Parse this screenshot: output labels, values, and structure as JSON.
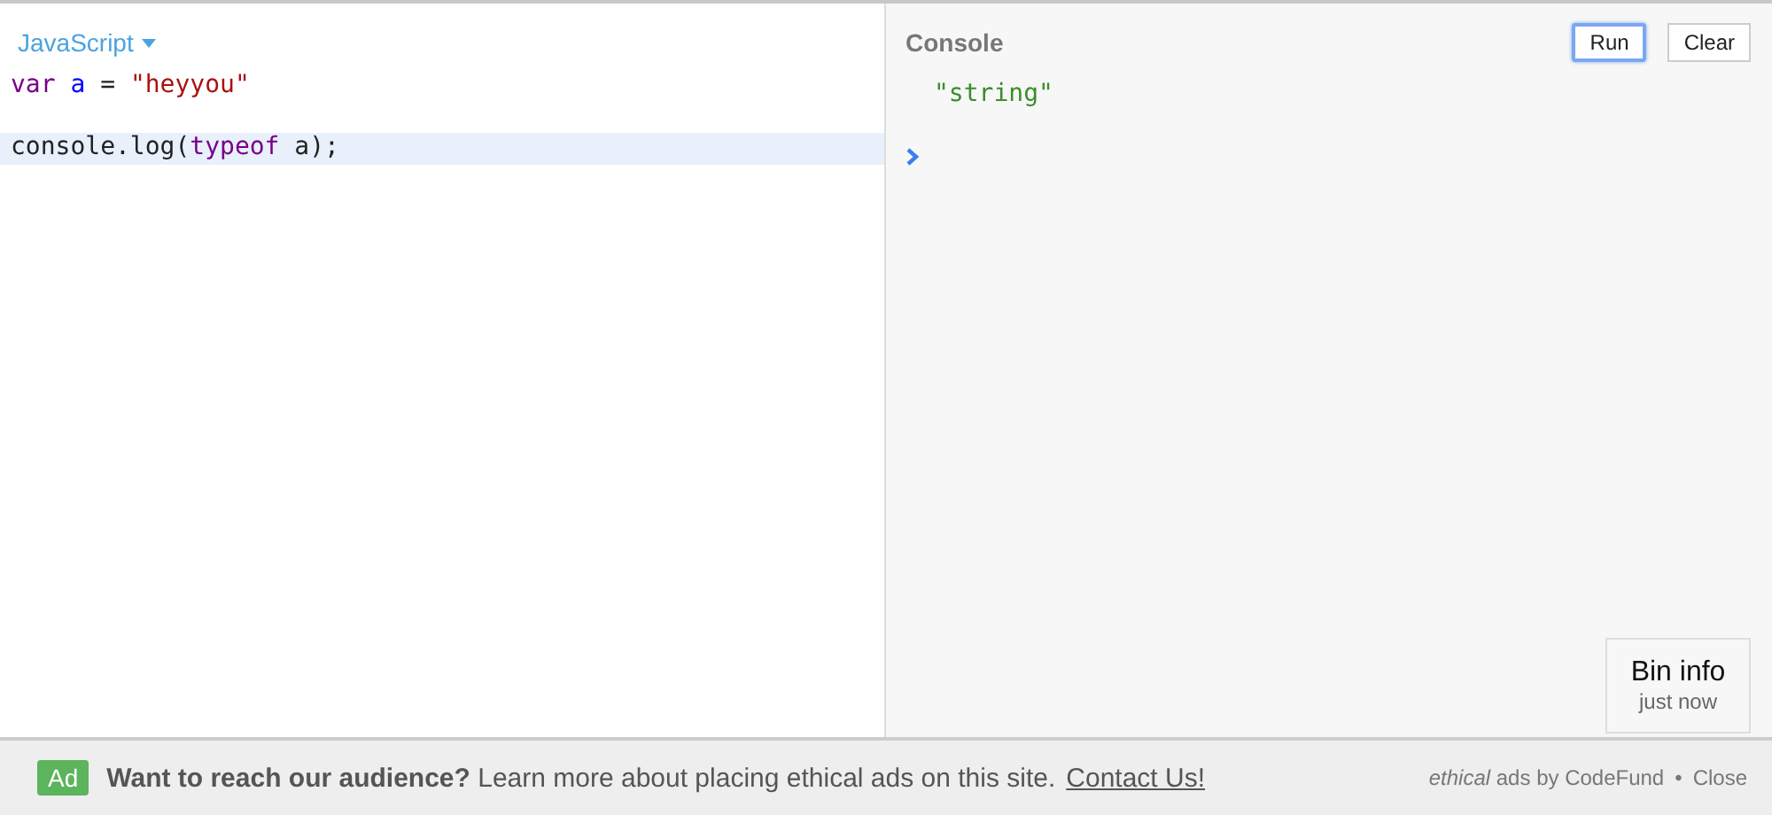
{
  "editor": {
    "language": "JavaScript",
    "lines": [
      {
        "tokens": [
          {
            "kind": "keyword",
            "text": "var "
          },
          {
            "kind": "variable",
            "text": "a"
          },
          {
            "kind": "plain",
            "text": " = "
          },
          {
            "kind": "string",
            "text": "\"heyyou\""
          }
        ]
      },
      {
        "active": true,
        "blank_line_before": true,
        "tokens": [
          {
            "kind": "plain",
            "text": "console.log("
          },
          {
            "kind": "keyword",
            "text": "typeof"
          },
          {
            "kind": "plain",
            "text": " a);"
          }
        ]
      }
    ]
  },
  "console": {
    "title": "Console",
    "buttons": [
      {
        "label": "Run",
        "focused": true
      },
      {
        "label": "Clear",
        "focused": false
      }
    ],
    "output": [
      {
        "kind": "string",
        "text": "\"string\""
      }
    ]
  },
  "bin_info": {
    "title": "Bin info",
    "time": "just now"
  },
  "ad": {
    "badge": "Ad",
    "message": "**Want to reach our audience?** Learn more about placing ethical ads on this site.",
    "link": "Contact Us!",
    "credit": "*ethical* ads by CodeFund",
    "separator": "•",
    "close": "Close"
  }
}
